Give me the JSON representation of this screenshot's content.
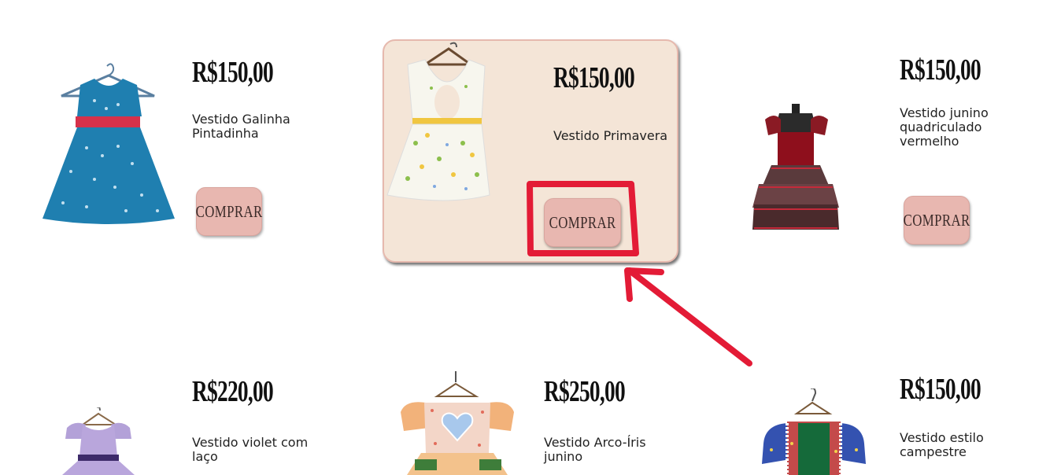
{
  "colors": {
    "button_bg": "#e8b7b0",
    "featured_bg": "#f4e5d7",
    "featured_border": "#e6b9ae",
    "annotation": "#e31b36"
  },
  "products": [
    {
      "price": "R$150,00",
      "name": "Vestido Galinha Pintadinha",
      "button": "COMPRAR",
      "image": "blue-polka-dot-dress"
    },
    {
      "price": "R$150,00",
      "name": "Vestido Primavera",
      "button": "COMPRAR",
      "image": "white-floral-dress",
      "featured": true
    },
    {
      "price": "R$150,00",
      "name": "Vestido junino quadriculado vermelho",
      "button": "COMPRAR",
      "image": "red-plaid-dress"
    },
    {
      "price": "R$220,00",
      "name": "Vestido violet com laço",
      "image": "purple-dress"
    },
    {
      "price": "R$250,00",
      "name": "Vestido Arco-Íris junino",
      "image": "patchwork-heart-dress"
    },
    {
      "price": "R$150,00",
      "name": "Vestido estilo campestre",
      "image": "country-style-dress"
    }
  ]
}
